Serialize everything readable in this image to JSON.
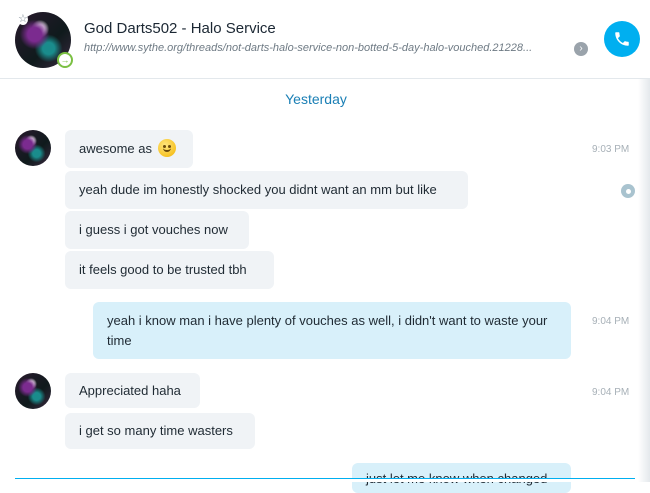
{
  "header": {
    "title": "God Darts502 - Halo Service",
    "subtitle": "http://www.sythe.org/threads/not-darts-halo-service-non-botted-5-day-halo-vouched.21228...",
    "star_icon": "☆",
    "presence_icon": "→"
  },
  "date_divider": "Yesterday",
  "messages": [
    {
      "text": "awesome as",
      "emoji": "smile-emoji",
      "time": "9:03 PM"
    },
    {
      "text": "yeah dude im honestly shocked you didnt want an mm but like"
    },
    {
      "text": "i guess i got vouches now"
    },
    {
      "text": "it feels good to be trusted tbh"
    },
    {
      "text": "yeah i know man i have plenty of vouches as well, i didn't want to waste your time",
      "time": "9:04 PM"
    },
    {
      "text": "Appreciated haha",
      "time": "9:04 PM"
    },
    {
      "text": "i get so many time wasters"
    },
    {
      "text": "just let me know when changed"
    }
  ],
  "colors": {
    "accent": "#00aff0",
    "incoming_bubble": "#f0f3f6",
    "outgoing_bubble": "#d8f0fa",
    "date_text": "#1a7fb5"
  }
}
